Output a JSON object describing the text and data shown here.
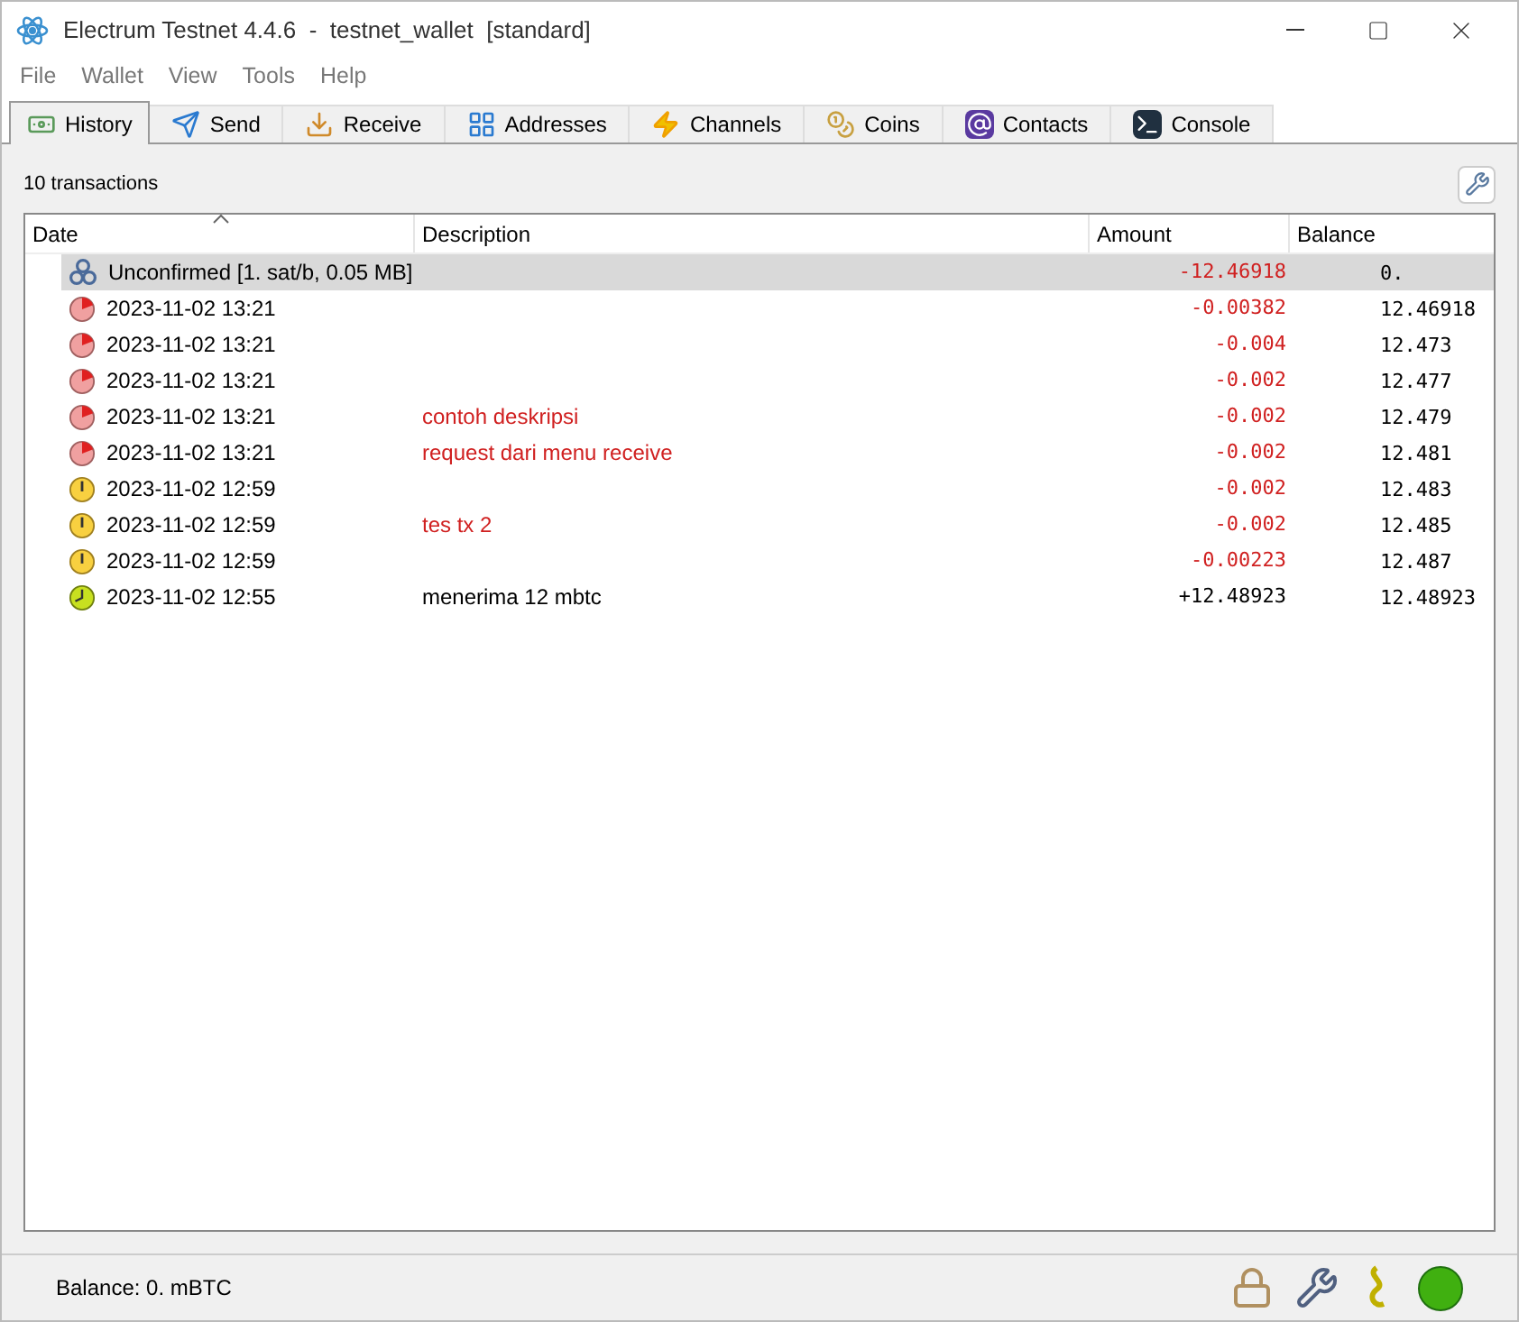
{
  "window": {
    "title": "Electrum Testnet 4.4.6  -  testnet_wallet  [standard]"
  },
  "menu": [
    "File",
    "Wallet",
    "View",
    "Tools",
    "Help"
  ],
  "tabs": [
    {
      "label": "History",
      "kind": "history",
      "selected": true
    },
    {
      "label": "Send",
      "kind": "send",
      "selected": false
    },
    {
      "label": "Receive",
      "kind": "receive",
      "selected": false
    },
    {
      "label": "Addresses",
      "kind": "addresses",
      "selected": false
    },
    {
      "label": "Channels",
      "kind": "channels",
      "selected": false
    },
    {
      "label": "Coins",
      "kind": "coins",
      "selected": false
    },
    {
      "label": "Contacts",
      "kind": "contacts",
      "selected": false
    },
    {
      "label": "Console",
      "kind": "console",
      "selected": false
    }
  ],
  "history": {
    "count": "10 transactions",
    "columns": [
      "Date",
      "Description",
      "Amount",
      "Balance"
    ],
    "rows": [
      {
        "kind": "unconfirmed",
        "date": "Unconfirmed [1. sat/b, 0.05 MB]",
        "amount": "-12.46918",
        "balance": "0.",
        "negative": true,
        "selected": true
      },
      {
        "kind": "pending",
        "date": "2023-11-02 13:21",
        "amount": "-0.00382",
        "balance": "12.46918",
        "negative": true,
        "selected": false
      },
      {
        "kind": "pending",
        "date": "2023-11-02 13:21",
        "amount": "-0.004",
        "balance": "12.473",
        "negative": true,
        "selected": false
      },
      {
        "kind": "pending",
        "date": "2023-11-02 13:21",
        "amount": "-0.002",
        "balance": "12.477",
        "negative": true,
        "selected": false
      },
      {
        "kind": "pending",
        "date": "2023-11-02 13:21",
        "description": "contoh deskripsi",
        "amount": "-0.002",
        "balance": "12.479",
        "negative": true,
        "selected": false
      },
      {
        "kind": "pending",
        "date": "2023-11-02 13:21",
        "description": "request dari menu receive",
        "amount": "-0.002",
        "balance": "12.481",
        "negative": true,
        "selected": false
      },
      {
        "kind": "waiting",
        "date": "2023-11-02 12:59",
        "amount": "-0.002",
        "balance": "12.483",
        "negative": true,
        "selected": false
      },
      {
        "kind": "waiting",
        "date": "2023-11-02 12:59",
        "description": "tes tx 2",
        "amount": "-0.002",
        "balance": "12.485",
        "negative": true,
        "selected": false
      },
      {
        "kind": "waiting",
        "date": "2023-11-02 12:59",
        "amount": "-0.00223",
        "balance": "12.487",
        "negative": true,
        "selected": false
      },
      {
        "kind": "confirming",
        "date": "2023-11-02 12:55",
        "description": "menerima 12 mbtc",
        "amount": "+12.48923",
        "balance": "12.48923",
        "negative": false,
        "selected": false
      }
    ]
  },
  "status_bar": {
    "balance": "Balance: 0. mBTC",
    "connected": true
  }
}
